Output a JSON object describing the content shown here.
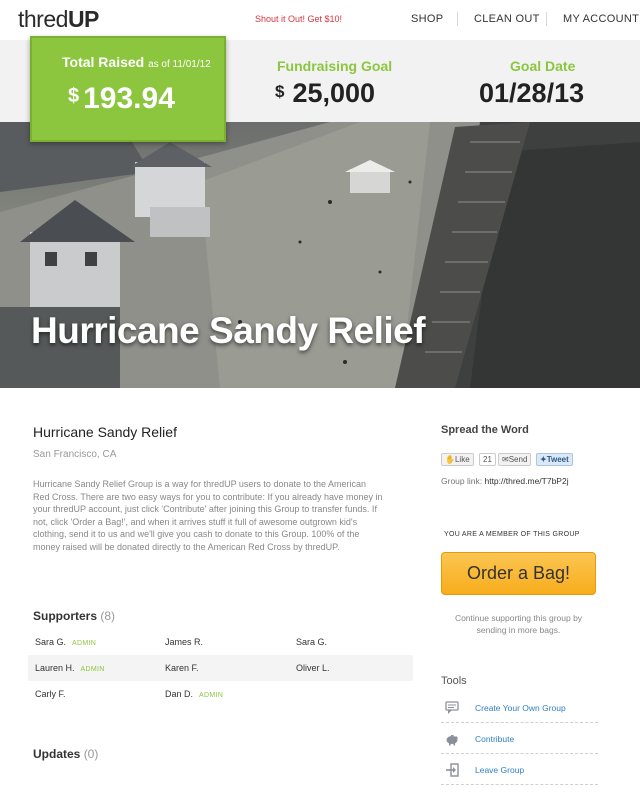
{
  "header": {
    "logo_pre": "thred",
    "logo_post": "UP",
    "promo": "Shout it Out! Get $10!",
    "nav": [
      "SHOP",
      "CLEAN OUT",
      "MY ACCOUNT"
    ]
  },
  "stats": {
    "total_label": "Total Raised",
    "total_date": "as of 11/01/12",
    "total_currency": "$",
    "total_amount": "193.94",
    "goal_label": "Fundraising Goal",
    "goal_currency": "$",
    "goal_amount": "25,000",
    "date_label": "Goal Date",
    "date_value": "01/28/13"
  },
  "hero": {
    "title": "Hurricane Sandy Relief"
  },
  "group": {
    "title": "Hurricane Sandy Relief",
    "location": "San Francisco, CA",
    "description": "Hurricane Sandy Relief Group is a way for thredUP users to donate to the American Red Cross. There are two easy ways for you to contribute: If you already have money in your thredUP account, just click 'Contribute' after joining this Group to transfer funds. If not, click 'Order a Bag!', and when it arrives stuff it full of awesome outgrown kid's clothing, send it to us and we'll give you cash to donate to this Group. 100% of the money raised will be donated directly to the American Red Cross by thredUP."
  },
  "supporters": {
    "label": "Supporters",
    "count": "(8)",
    "admin_tag": "ADMIN",
    "rows": [
      [
        "Sara G.",
        "James R.",
        "Sara G."
      ],
      [
        "Lauren H.",
        "Karen F.",
        "Oliver L."
      ],
      [
        "Carly F.",
        "Dan D."
      ]
    ]
  },
  "updates": {
    "label": "Updates",
    "count": "(0)"
  },
  "sidebar": {
    "spread_label": "Spread the Word",
    "like_label": "Like",
    "like_count": "21",
    "send_label": "Send",
    "tweet_label": "Tweet",
    "group_link_label": "Group link:",
    "group_link_url": "http://thred.me/T7bP2j",
    "member_text": "YOU ARE A MEMBER OF THIS GROUP",
    "order_button": "Order a Bag!",
    "continue_text": "Continue supporting this group by sending in more bags.",
    "tools_label": "Tools",
    "tools": [
      "Create Your Own Group",
      "Contribute",
      "Leave Group"
    ]
  },
  "colors": {
    "brand_green": "#8cc63f",
    "order_orange": "#f7ad1c",
    "link_blue": "#2f7fc1",
    "promo_red": "#d9363e"
  }
}
